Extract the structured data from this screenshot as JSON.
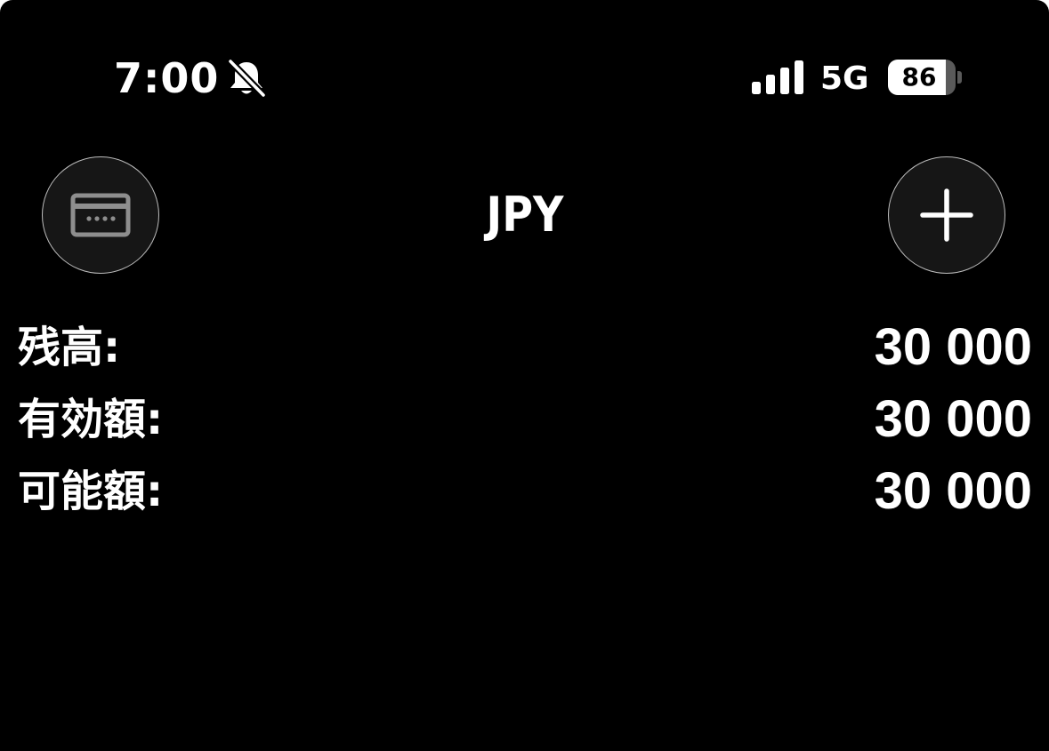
{
  "status_bar": {
    "time": "7:00",
    "network": "5G",
    "battery_level": "86",
    "battery_fraction": 0.86,
    "signal_bars": 4
  },
  "header": {
    "title": "JPY",
    "left_button_icon": "card-icon",
    "right_button_icon": "plus-icon"
  },
  "balances": [
    {
      "label": "残高:",
      "value": "30 000"
    },
    {
      "label": "有効額:",
      "value": "30 000"
    },
    {
      "label": "可能額:",
      "value": "30 000"
    }
  ],
  "colors": {
    "background": "#000000",
    "text": "#ffffff",
    "button_fill": "#161616",
    "button_border": "#bdbdbd",
    "card_icon": "#8e8e8e"
  }
}
